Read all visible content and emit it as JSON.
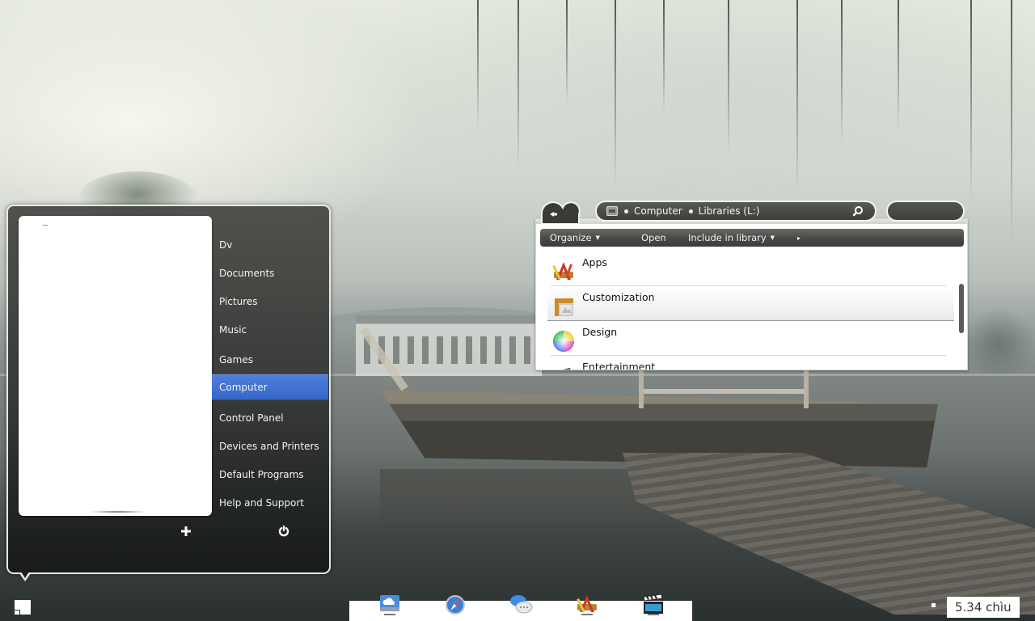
{
  "start_menu": {
    "places": [
      {
        "label": "Dv",
        "active": false
      },
      {
        "label": "Documents",
        "active": false
      },
      {
        "label": "Pictures",
        "active": false
      },
      {
        "label": "Music",
        "active": false
      },
      {
        "label": "Games",
        "active": false
      },
      {
        "label": "Computer",
        "active": true
      },
      {
        "label": "Control Panel",
        "active": false
      },
      {
        "label": "Devices and Printers",
        "active": false
      },
      {
        "label": "Default Programs",
        "active": false
      },
      {
        "label": "Help and Support",
        "active": false
      }
    ],
    "add_icon": "plus-icon",
    "power_icon": "power-icon",
    "accent_color": "#3f6fd1"
  },
  "explorer": {
    "breadcrumb": [
      "Computer",
      "Libraries (L:)"
    ],
    "toolbar": {
      "organize": "Organize",
      "open": "Open",
      "include_in_library": "Include in library",
      "more": "▸"
    },
    "items": [
      {
        "label": "Apps",
        "icon": "apps-icon"
      },
      {
        "label": "Customization",
        "icon": "customization-icon"
      },
      {
        "label": "Design",
        "icon": "color-wheel-icon"
      },
      {
        "label": "Entertainment",
        "icon": "entertainment-icon"
      }
    ]
  },
  "dock": {
    "apps": [
      {
        "name": "icloud-drive",
        "running": true
      },
      {
        "name": "safari",
        "running": false
      },
      {
        "name": "messages",
        "running": false
      },
      {
        "name": "xcode",
        "running": true
      },
      {
        "name": "video-editor",
        "running": true
      }
    ]
  },
  "clock": {
    "time": "5.34 chìu"
  }
}
